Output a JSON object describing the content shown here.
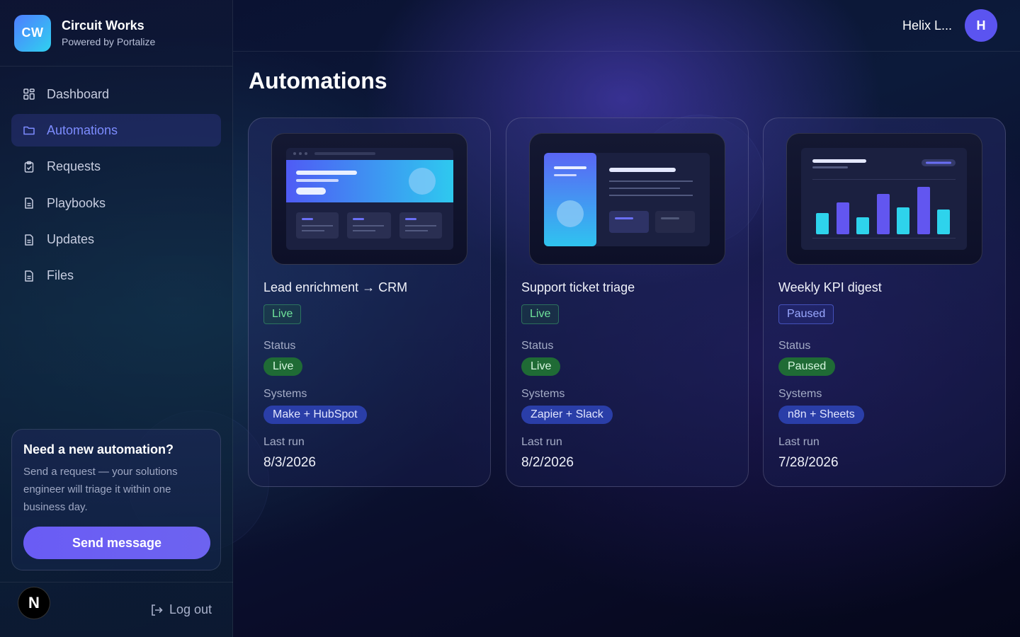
{
  "brand": {
    "logo": "CW",
    "name": "Circuit Works",
    "subtitle": "Powered by Portalize"
  },
  "nav": {
    "items": [
      {
        "label": "Dashboard",
        "icon": "grid-icon",
        "active": false
      },
      {
        "label": "Automations",
        "icon": "folder-icon",
        "active": true
      },
      {
        "label": "Requests",
        "icon": "clipboard-icon",
        "active": false
      },
      {
        "label": "Playbooks",
        "icon": "document-icon",
        "active": false
      },
      {
        "label": "Updates",
        "icon": "document-icon",
        "active": false
      },
      {
        "label": "Files",
        "icon": "document-icon",
        "active": false
      }
    ]
  },
  "cta": {
    "title": "Need a new automation?",
    "text": "Send a request — your solutions engineer will triage it within one business day.",
    "button": "Send message"
  },
  "footer": {
    "avatar": "N",
    "logout": "Log out"
  },
  "topbar": {
    "user_name": "Helix L...",
    "avatar": "H"
  },
  "page": {
    "title": "Automations"
  },
  "labels": {
    "status": "Status",
    "systems": "Systems",
    "last_run": "Last run"
  },
  "cards": [
    {
      "title": "Lead enrichment → CRM",
      "badge": "Live",
      "status": "Live",
      "systems": "Make + HubSpot",
      "last_run": "8/3/2026"
    },
    {
      "title": "Support ticket triage",
      "badge": "Live",
      "status": "Live",
      "systems": "Zapier + Slack",
      "last_run": "8/2/2026"
    },
    {
      "title": "Weekly KPI digest",
      "badge": "Paused",
      "status": "Paused",
      "systems": "n8n + Sheets",
      "last_run": "7/28/2026"
    }
  ],
  "colors": {
    "accent": "#6a5cf5",
    "live": "#6fe39b",
    "paused": "#9aa8ff",
    "brand_gradient_start": "#4f7dff",
    "brand_gradient_end": "#2fd1f0"
  }
}
